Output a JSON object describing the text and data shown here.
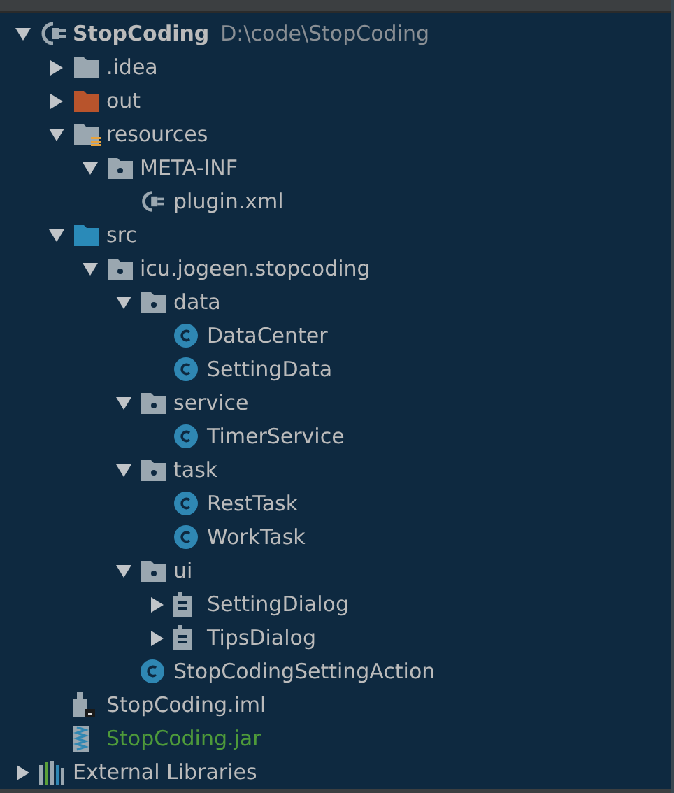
{
  "tree": [
    {
      "label": "StopCoding",
      "path": "D:\\code\\StopCoding",
      "kind": "module",
      "expanded": true,
      "children": [
        {
          "label": ".idea",
          "kind": "folder",
          "expanded": false
        },
        {
          "label": "out",
          "kind": "excluded-folder",
          "expanded": false
        },
        {
          "label": "resources",
          "kind": "resources-folder",
          "expanded": true,
          "children": [
            {
              "label": "META-INF",
              "kind": "package",
              "expanded": true,
              "children": [
                {
                  "label": "plugin.xml",
                  "kind": "plugin-file"
                }
              ]
            }
          ]
        },
        {
          "label": "src",
          "kind": "source-folder",
          "expanded": true,
          "children": [
            {
              "label": "icu.jogeen.stopcoding",
              "kind": "package",
              "expanded": true,
              "children": [
                {
                  "label": "data",
                  "kind": "package",
                  "expanded": true,
                  "children": [
                    {
                      "label": "DataCenter",
                      "kind": "class"
                    },
                    {
                      "label": "SettingData",
                      "kind": "class"
                    }
                  ]
                },
                {
                  "label": "service",
                  "kind": "package",
                  "expanded": true,
                  "children": [
                    {
                      "label": "TimerService",
                      "kind": "class"
                    }
                  ]
                },
                {
                  "label": "task",
                  "kind": "package",
                  "expanded": true,
                  "children": [
                    {
                      "label": "RestTask",
                      "kind": "class"
                    },
                    {
                      "label": "WorkTask",
                      "kind": "class"
                    }
                  ]
                },
                {
                  "label": "ui",
                  "kind": "package",
                  "expanded": true,
                  "children": [
                    {
                      "label": "SettingDialog",
                      "kind": "form",
                      "expanded": false
                    },
                    {
                      "label": "TipsDialog",
                      "kind": "form",
                      "expanded": false
                    }
                  ]
                },
                {
                  "label": "StopCodingSettingAction",
                  "kind": "class"
                }
              ]
            }
          ]
        },
        {
          "label": "StopCoding.iml",
          "kind": "iml"
        },
        {
          "label": "StopCoding.jar",
          "kind": "jar"
        }
      ]
    },
    {
      "label": "External Libraries",
      "kind": "libraries",
      "expanded": false
    }
  ]
}
